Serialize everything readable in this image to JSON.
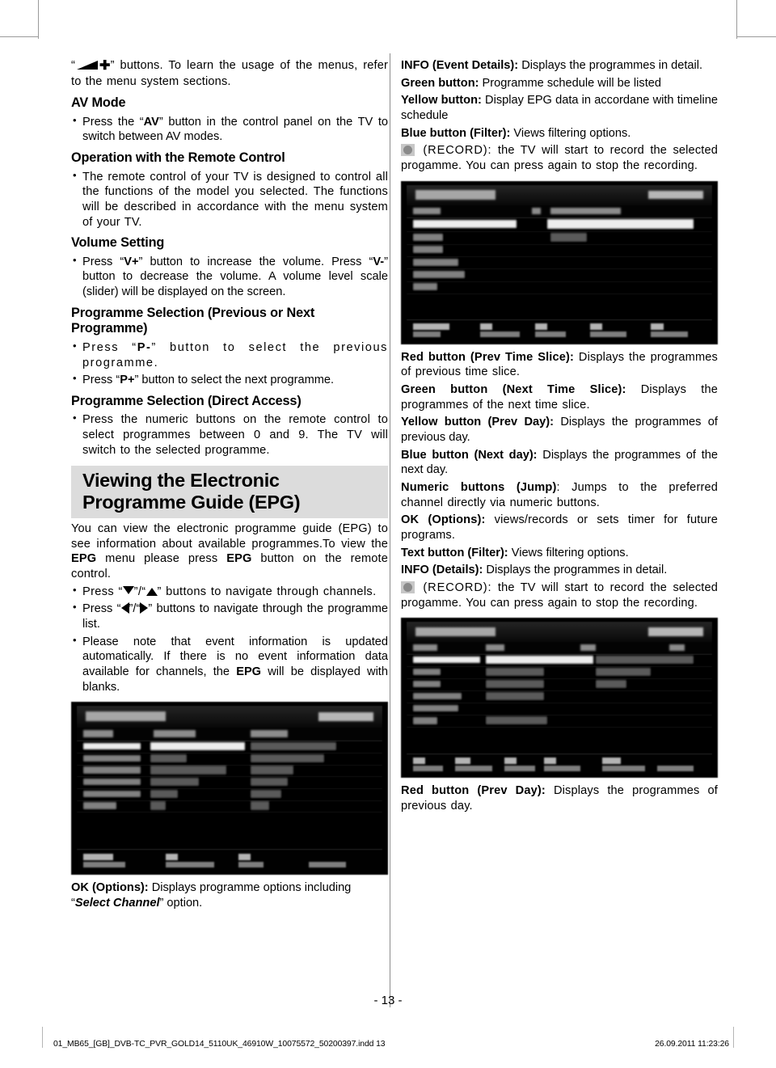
{
  "page": {
    "number_label": "- 13 -",
    "footer_file": "01_MB65_[GB]_DVB-TC_PVR_GOLD14_5110UK_46910W_10075572_50200397.indd   13",
    "footer_date": "26.09.2011   11:23:26"
  },
  "left_column": {
    "intro_quote_suffix": "” buttons. To learn the usage of the menus, refer to the menu system sections.",
    "av_mode": {
      "heading": "AV Mode",
      "bullets": [
        "Press the “AV” button in the control panel on the TV to switch between AV modes."
      ]
    },
    "remote_operation": {
      "heading": "Operation with the Remote Control",
      "bullets": [
        "The remote control of your TV is designed to control all the functions of the model you selected. The functions will be described in accordance with the menu system of your TV."
      ]
    },
    "volume": {
      "heading": "Volume Setting",
      "bullet_a": "Press “",
      "bullet_v_plus": "V+",
      "bullet_b": "” button to increase the volume. Press “",
      "bullet_v_minus": "V-",
      "bullet_c": "” button to decrease the volume. A volume level scale (slider) will be displayed on the screen."
    },
    "prog_prev_next": {
      "heading": "Programme Selection (Previous or Next Programme)",
      "b1_a": "Press “",
      "b1_key": "P-",
      "b1_b": "” button to select the previous programme.",
      "b2_a": "Press “",
      "b2_key": "P+",
      "b2_b": "” button to select the next programme."
    },
    "prog_direct": {
      "heading": "Programme Selection (Direct Access)",
      "bullets": [
        "Press the numeric buttons on the remote control to select programmes between 0 and 9. The TV will switch to the selected programme."
      ]
    },
    "epg_section": {
      "heading_line1": "Viewing the Electronic",
      "heading_line2": "Programme Guide (EPG)",
      "intro_a": "You can view the electronic programme guide (EPG) to see information about available programmes.To view the ",
      "intro_epg1": "EPG",
      "intro_b": " menu please press ",
      "intro_epg2": "EPG",
      "intro_c": " button on the remote control.",
      "nav_channels_a": "Press “",
      "nav_channels_b": "”/“",
      "nav_channels_c": "”  buttons to navigate through channels.",
      "nav_list_a": "Press “",
      "nav_list_b": "”/“",
      "nav_list_c": "” buttons to navigate through the programme list.",
      "note_a": "Please note that event information is updated automatically. If there is no event information data available for channels, the ",
      "note_epg": "EPG",
      "note_b": " will be displayed with blanks."
    },
    "ok_options": {
      "label": "OK (Options):",
      "text_a": " Displays programme options including “",
      "emphasis": "Select Channel",
      "text_b": "” option."
    }
  },
  "right_column": {
    "items_top": [
      {
        "label": "INFO (Event Details):",
        "text": " Displays the programmes in detail."
      },
      {
        "label": "Green button:",
        "text": " Programme schedule will be listed"
      },
      {
        "label": "Yellow button:",
        "text": " Display EPG data in accordane with timeline schedule"
      },
      {
        "label": "Blue button (Filter):",
        "text": " Views filtering options."
      }
    ],
    "record_top": {
      "icon": "record-icon",
      "label": "(RECORD):",
      "text": " the TV will start to record the selected progamme. You can press again to stop the recording."
    },
    "items_mid": [
      {
        "label": "Red button (Prev Time Slice):",
        "text": " Displays the programmes of previous time slice."
      },
      {
        "label": "Green button (Next Time Slice):",
        "text": " Displays the programmes of the next time slice."
      },
      {
        "label": "Yellow button (Prev Day):",
        "text": " Displays the programmes of previous day."
      },
      {
        "label": "Blue button (Next day):",
        "text": " Displays the programmes of the next day."
      },
      {
        "label": "Numeric buttons (Jump)",
        "text": ": Jumps to the preferred channel directly via numeric buttons."
      },
      {
        "label": "OK (Options):",
        "text": " views/records or sets timer for future programs."
      },
      {
        "label": "Text button (Filter):",
        "text": " Views filtering options."
      },
      {
        "label": "INFO (Details):",
        "text": " Displays the programmes in detail."
      }
    ],
    "record_bottom": {
      "icon": "record-icon",
      "label": "(RECORD):",
      "text": " the TV will start to record the selected progamme. You can press again to stop the recording."
    },
    "items_bottom": [
      {
        "label": "Red button (Prev Day):",
        "text": " Displays the programmes of previous day."
      }
    ]
  },
  "colors": {
    "heading_band": "#dcdcdc",
    "record_icon_fill": "#8a8a8a",
    "record_icon_bg": "#c7c7c7",
    "divider": "#8d8d8d"
  }
}
